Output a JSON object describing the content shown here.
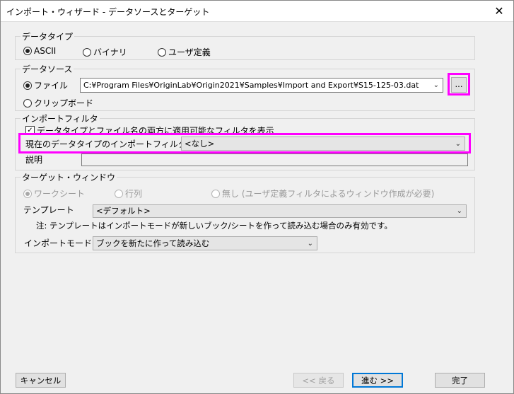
{
  "window": {
    "title": "インポート・ウィザード - データソースとターゲット",
    "close_symbol": "✕"
  },
  "data_type": {
    "group_title": "データタイプ",
    "options": [
      {
        "label": "ASCII",
        "selected": true
      },
      {
        "label": "バイナリ",
        "selected": false
      },
      {
        "label": "ユーザ定義",
        "selected": false
      }
    ]
  },
  "data_source": {
    "group_title": "データソース",
    "file_label": "ファイル",
    "file_path": "C:¥Program Files¥OriginLab¥Origin2021¥Samples¥Import and Export¥S15-125-03.dat",
    "browse_label": "...",
    "clipboard_label": "クリップボード"
  },
  "import_filter": {
    "group_title": "インポートフィルタ",
    "checkbox_label": "データタイプとファイル名の両方に適用可能なフィルタを表示",
    "checkbox_checked": true,
    "current_filter_label": "現在のデータタイプのインポートフィルタ",
    "current_filter_value": "<なし>",
    "description_label": "説明",
    "description_value": ""
  },
  "target_window": {
    "group_title": "ターゲット・ウィンドウ",
    "options": [
      {
        "label": "ワークシート",
        "selected": true
      },
      {
        "label": "行列",
        "selected": false
      },
      {
        "label": "無し (ユーザ定義フィルタによるウィンドウ作成が必要)",
        "selected": false
      }
    ],
    "template_label": "テンプレート",
    "template_value": "<デフォルト>",
    "note": "注: テンプレートはインポートモードが新しいブック/シートを作って読み込む場合のみ有効です。",
    "import_mode_label": "インポートモード",
    "import_mode_value": "ブックを新たに作って読み込む"
  },
  "footer": {
    "cancel": "キャンセル",
    "back": "<< 戻る",
    "next": "進む >>",
    "finish": "完了"
  },
  "colors": {
    "highlight": "#ff00ff",
    "focus": "#0078d7"
  }
}
